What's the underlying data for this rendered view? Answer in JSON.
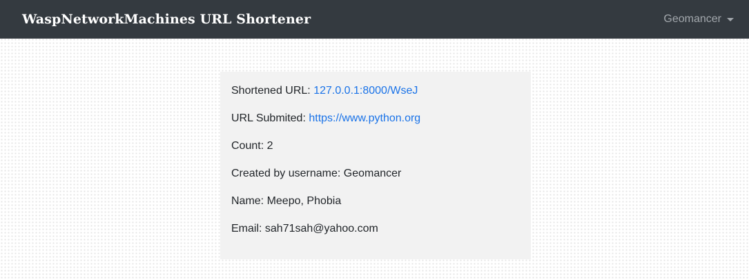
{
  "navbar": {
    "brand": "WaspNetworkMachines URL Shortener",
    "user_menu_label": "Geomancer"
  },
  "details": {
    "shortened_url": {
      "label": "Shortened URL:",
      "value": "127.0.0.1:8000/WseJ"
    },
    "url_submitted": {
      "label": "URL Submited:",
      "value": "https://www.python.org"
    },
    "count": {
      "label": "Count:",
      "value": "2"
    },
    "created_by": {
      "label": "Created by username:",
      "value": "Geomancer"
    },
    "name": {
      "label": "Name:",
      "value": "Meepo, Phobia"
    },
    "email": {
      "label": "Email:",
      "value": "sah71sah@yahoo.com"
    }
  },
  "colors": {
    "navbar_bg": "#343a40",
    "card_bg": "#f2f2f2",
    "link": "#1a73e8",
    "menu_text": "#a3a8ad"
  },
  "icons": {
    "user_menu_caret": "caret-down-icon"
  }
}
